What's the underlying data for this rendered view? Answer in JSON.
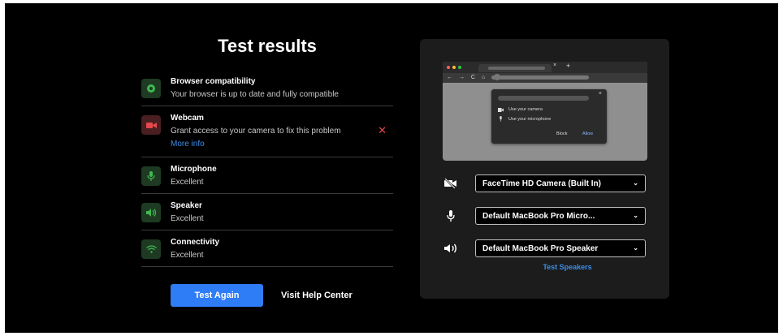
{
  "title": "Test results",
  "results": [
    {
      "title": "Browser compatibility",
      "subtitle": "Your browser is up to date and fully compatible",
      "icon": "chrome-icon",
      "status": "ok"
    },
    {
      "title": "Webcam",
      "subtitle": "Grant access to your camera to fix this problem",
      "link": "More info",
      "icon": "camera-icon",
      "status": "error"
    },
    {
      "title": "Microphone",
      "subtitle": "Excellent",
      "icon": "microphone-icon",
      "status": "ok"
    },
    {
      "title": "Speaker",
      "subtitle": "Excellent",
      "icon": "speaker-icon",
      "status": "ok"
    },
    {
      "title": "Connectivity",
      "subtitle": "Excellent",
      "icon": "wifi-icon",
      "status": "ok"
    }
  ],
  "buttons": {
    "test_again": "Test Again",
    "help_center": "Visit Help Center"
  },
  "preview": {
    "tab_close": "×",
    "tab_new": "+",
    "nav_glyphs": "← → C ⌂",
    "use_camera": "Use your camera",
    "use_microphone": "Use your microphone",
    "block": "Block",
    "allow": "Allow",
    "dialog_close": "×"
  },
  "devices": {
    "camera": "FaceTime HD Camera (Built In)",
    "microphone": "Default MacBook Pro Micro...",
    "speaker": "Default MacBook Pro Speaker",
    "test_speakers": "Test Speakers"
  },
  "colors": {
    "accent": "#2e7cf6",
    "ok_icon": "#3fb950",
    "error": "#e5484d",
    "link": "#3b8eea"
  }
}
